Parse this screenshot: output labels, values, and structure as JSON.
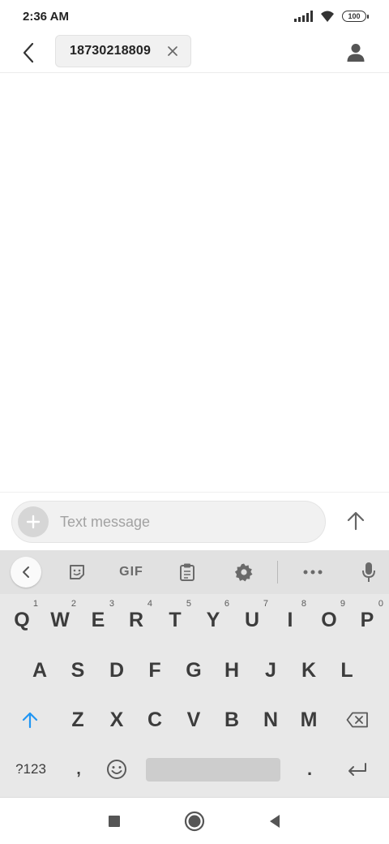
{
  "status_bar": {
    "time": "2:36 AM",
    "battery": "100"
  },
  "header": {
    "recipient": "18730218809",
    "icons": {
      "back": "back-arrow-icon",
      "chip_close": "close-icon",
      "contact": "person-icon"
    }
  },
  "compose": {
    "placeholder": "Text message",
    "icons": {
      "attach": "plus-icon",
      "send": "arrow-up-icon"
    }
  },
  "keyboard": {
    "toolbar": {
      "gif": "GIF",
      "icons": [
        "chevron-left-icon",
        "sticker-icon",
        "gif",
        "clipboard-icon",
        "gear-icon",
        "more-icon",
        "mic-icon"
      ]
    },
    "row1": [
      {
        "key": "Q",
        "hint": "1"
      },
      {
        "key": "W",
        "hint": "2"
      },
      {
        "key": "E",
        "hint": "3"
      },
      {
        "key": "R",
        "hint": "4"
      },
      {
        "key": "T",
        "hint": "5"
      },
      {
        "key": "Y",
        "hint": "6"
      },
      {
        "key": "U",
        "hint": "7"
      },
      {
        "key": "I",
        "hint": "8"
      },
      {
        "key": "O",
        "hint": "9"
      },
      {
        "key": "P",
        "hint": "0"
      }
    ],
    "row2": [
      "A",
      "S",
      "D",
      "F",
      "G",
      "H",
      "J",
      "K",
      "L"
    ],
    "row3": [
      "Z",
      "X",
      "C",
      "V",
      "B",
      "N",
      "M"
    ],
    "row4": {
      "symbols": "?123",
      "comma": ",",
      "period": "."
    },
    "colors": {
      "shift_accent": "#2196f3",
      "background": "#e8e8e8"
    }
  },
  "nav_bar": {
    "icons": [
      "recents-square-icon",
      "home-circle-icon",
      "back-triangle-icon"
    ]
  }
}
